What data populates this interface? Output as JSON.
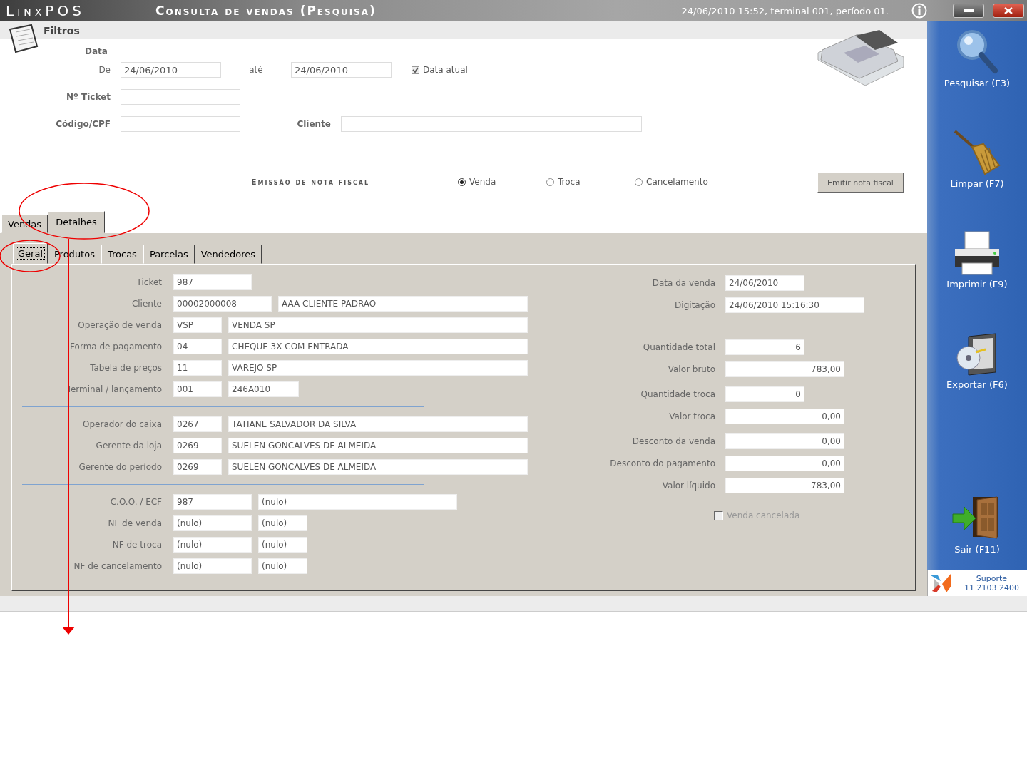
{
  "title_bar": {
    "logo": "LinxPOS",
    "title": "Consulta de vendas (Pesquisa)",
    "status": "24/06/2010 15:52, terminal 001, período 01."
  },
  "filters": {
    "heading": "Filtros",
    "date_heading": "Data",
    "from_label": "De",
    "from_value": "24/06/2010",
    "to_label": "até",
    "to_value": "24/06/2010",
    "current_date": {
      "label": "Data atual",
      "checked": true
    },
    "ticket_label": "Nº Ticket",
    "code_label": "Código/CPF",
    "client_label": "Cliente"
  },
  "invoice": {
    "label": "Emissão de nota fiscal",
    "options": [
      {
        "label": "Venda",
        "selected": true
      },
      {
        "label": "Troca",
        "selected": false
      },
      {
        "label": "Cancelamento",
        "selected": false
      }
    ],
    "button": "Emitir nota fiscal"
  },
  "tabs": [
    {
      "label": "Vendas",
      "selected": false
    },
    {
      "label": "Detalhes",
      "selected": true
    }
  ],
  "subtabs": [
    {
      "label": "Geral",
      "selected": true
    },
    {
      "label": "Produtos",
      "selected": false
    },
    {
      "label": "Trocas",
      "selected": false
    },
    {
      "label": "Parcelas",
      "selected": false
    },
    {
      "label": "Vendedores",
      "selected": false
    }
  ],
  "left_groups": [
    [
      {
        "label": "Ticket",
        "values": [
          "987"
        ]
      },
      {
        "label": "Cliente",
        "values": [
          "00002000008",
          "AAA CLIENTE PADRAO"
        ]
      },
      {
        "label": "Operação de venda",
        "values": [
          "VSP",
          "VENDA SP"
        ]
      },
      {
        "label": "Forma de pagamento",
        "values": [
          "04",
          "CHEQUE 3X COM ENTRADA"
        ]
      },
      {
        "label": "Tabela de preços",
        "values": [
          "11",
          "VAREJO SP"
        ]
      },
      {
        "label": "Terminal / lançamento",
        "values": [
          "001",
          "246A010"
        ]
      }
    ],
    [
      {
        "label": "Operador do caixa",
        "values": [
          "0267",
          "TATIANE SALVADOR DA SILVA"
        ]
      },
      {
        "label": "Gerente da loja",
        "values": [
          "0269",
          "SUELEN GONCALVES DE ALMEIDA"
        ]
      },
      {
        "label": "Gerente do período",
        "values": [
          "0269",
          "SUELEN GONCALVES DE ALMEIDA"
        ]
      }
    ],
    [
      {
        "label": "C.O.O. / ECF",
        "values": [
          "987",
          "(nulo)"
        ]
      },
      {
        "label": "NF de venda",
        "values": [
          "(nulo)",
          "(nulo)"
        ]
      },
      {
        "label": "NF de troca",
        "values": [
          "(nulo)",
          "(nulo)"
        ]
      },
      {
        "label": "NF de cancelamento",
        "values": [
          "(nulo)",
          "(nulo)"
        ]
      }
    ]
  ],
  "right_groups": [
    [
      {
        "label": "Data da venda",
        "value": "24/06/2010"
      },
      {
        "label": "Digitação",
        "value": "24/06/2010 15:16:30"
      }
    ],
    [
      {
        "label": "Quantidade total",
        "value": "6"
      },
      {
        "label": "Valor bruto",
        "value": "783,00"
      }
    ],
    [
      {
        "label": "Quantidade troca",
        "value": "0"
      },
      {
        "label": "Valor troca",
        "value": "0,00"
      }
    ],
    [
      {
        "label": "Desconto da venda",
        "value": "0,00"
      },
      {
        "label": "Desconto do pagamento",
        "value": "0,00"
      },
      {
        "label": "Valor líquido",
        "value": "783,00"
      }
    ]
  ],
  "cancelled": {
    "label": "Venda cancelada",
    "checked": false
  },
  "sidebar": [
    {
      "label": "Pesquisar (F3)",
      "kind": "search"
    },
    {
      "label": "Limpar (F7)",
      "kind": "broom"
    },
    {
      "label": "Imprimir (F9)",
      "kind": "printer"
    },
    {
      "label": "Exportar (F6)",
      "kind": "export"
    },
    {
      "label": "Sair (F11)",
      "kind": "exit"
    }
  ],
  "support": {
    "title": "Suporte",
    "phone": "11 2103 2400"
  }
}
